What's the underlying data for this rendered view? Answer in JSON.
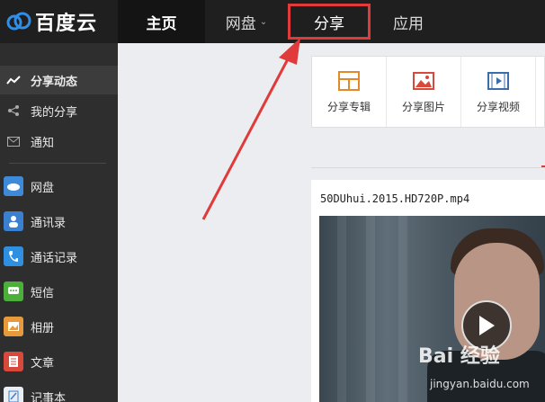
{
  "header": {
    "logo_text": "百度云",
    "nav": {
      "home": "主页",
      "pan": "网盘",
      "share": "分享",
      "apps": "应用"
    }
  },
  "sidebar": {
    "items": [
      {
        "label": "分享动态",
        "icon": "activity-icon"
      },
      {
        "label": "我的分享",
        "icon": "share-icon"
      },
      {
        "label": "通知",
        "icon": "mail-icon"
      },
      {
        "label": "网盘",
        "icon": "cloud-icon"
      },
      {
        "label": "通讯录",
        "icon": "contacts-icon"
      },
      {
        "label": "通话记录",
        "icon": "phone-icon"
      },
      {
        "label": "短信",
        "icon": "sms-icon"
      },
      {
        "label": "相册",
        "icon": "photo-icon"
      },
      {
        "label": "文章",
        "icon": "article-icon"
      },
      {
        "label": "记事本",
        "icon": "notepad-icon"
      }
    ]
  },
  "toolbar": {
    "items": [
      {
        "label": "分享专辑",
        "icon": "album-icon"
      },
      {
        "label": "分享图片",
        "icon": "image-icon"
      },
      {
        "label": "分享视频",
        "icon": "video-icon"
      }
    ]
  },
  "feed": {
    "video_title": "50DUhui.2015.HD720P.mp4"
  },
  "watermark": {
    "brand": "Bai 经验",
    "url": "jingyan.baidu.com"
  },
  "colors": {
    "topbar": "#1f1f1f",
    "sidebar": "#2e2e2e",
    "highlight": "#e03a3a"
  }
}
